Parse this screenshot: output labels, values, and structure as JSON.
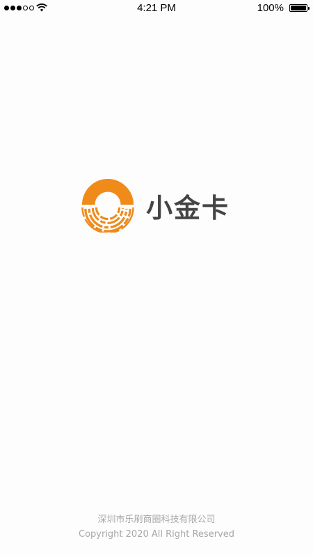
{
  "status_bar": {
    "time": "4:21 PM",
    "battery_percent": "100%",
    "signal_bars_filled": 3,
    "signal_bars_total": 5,
    "battery_level": 1.0
  },
  "brand": {
    "name": "小金卡",
    "logo_icon": "orange-ring-logo-icon",
    "accent_color": "#f08a19",
    "text_color": "#444444"
  },
  "footer": {
    "company": "深圳市乐刷商圈科技有限公司",
    "copyright": "Copyright 2020 All Right Reserved"
  }
}
